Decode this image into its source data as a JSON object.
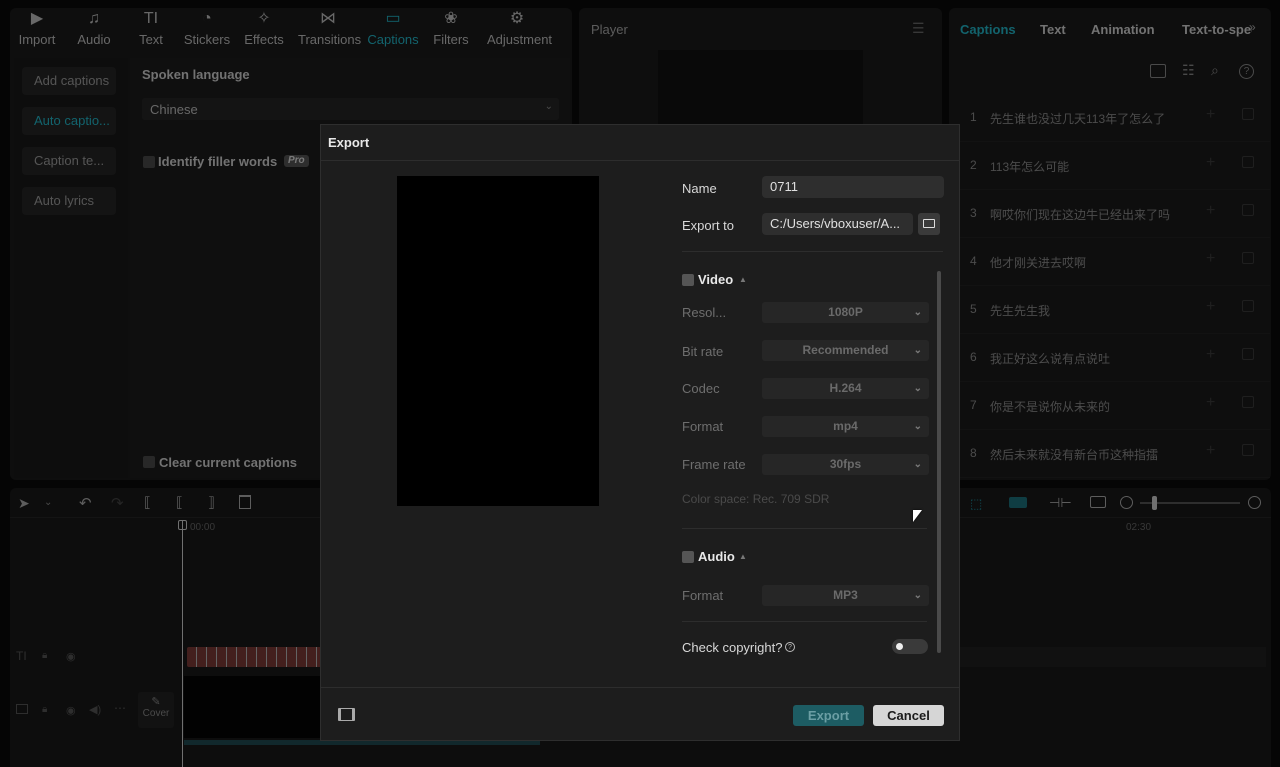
{
  "toolbar": {
    "items": [
      {
        "label": "Import",
        "icon": "import-icon"
      },
      {
        "label": "Audio",
        "icon": "audio-icon"
      },
      {
        "label": "Text",
        "icon": "text-icon"
      },
      {
        "label": "Stickers",
        "icon": "stickers-icon"
      },
      {
        "label": "Effects",
        "icon": "effects-icon"
      },
      {
        "label": "Transitions",
        "icon": "transitions-icon"
      },
      {
        "label": "Captions",
        "icon": "captions-icon",
        "active": true
      },
      {
        "label": "Filters",
        "icon": "filters-icon"
      },
      {
        "label": "Adjustment",
        "icon": "adjustment-icon"
      }
    ]
  },
  "caption_panel": {
    "side_buttons": [
      "Add captions",
      "Auto captio...",
      "Caption te...",
      "Auto lyrics"
    ],
    "spoken_language_label": "Spoken language",
    "language_value": "Chinese",
    "filler_label": "Identify filler words",
    "pro_badge": "Pro",
    "clear_label": "Clear current captions"
  },
  "player": {
    "title": "Player"
  },
  "right_panel": {
    "tabs": [
      "Captions",
      "Text",
      "Animation",
      "Text-to-speech"
    ],
    "captions": [
      {
        "n": "1",
        "text": "先生谁也没过几天113年了怎么了"
      },
      {
        "n": "2",
        "text": "113年怎么可能"
      },
      {
        "n": "3",
        "text": "啊哎你们现在这边牛已经出来了吗"
      },
      {
        "n": "4",
        "text": "他才刚关进去哎啊"
      },
      {
        "n": "5",
        "text": "先生先生我"
      },
      {
        "n": "6",
        "text": "我正好这么说有点说吐"
      },
      {
        "n": "7",
        "text": "你是不是说你从未来的"
      },
      {
        "n": "8",
        "text": "然后未来就没有新台币这种指擂"
      }
    ]
  },
  "timeline": {
    "time_start": "00:00",
    "time_mark": "02:30",
    "cover_label": "Cover"
  },
  "export_dialog": {
    "title": "Export",
    "name_label": "Name",
    "name_value": "0711",
    "export_to_label": "Export to",
    "export_to_value": "C:/Users/vboxuser/A...",
    "video_label": "Video",
    "resolution_label": "Resol...",
    "resolution_value": "1080P",
    "bitrate_label": "Bit rate",
    "bitrate_value": "Recommended",
    "codec_label": "Codec",
    "codec_value": "H.264",
    "format_label": "Format",
    "format_value": "mp4",
    "framerate_label": "Frame rate",
    "framerate_value": "30fps",
    "colorspace_text": "Color space: Rec. 709 SDR",
    "audio_label": "Audio",
    "audio_format_label": "Format",
    "audio_format_value": "MP3",
    "copyright_label": "Check copyright?",
    "export_button": "Export",
    "cancel_button": "Cancel"
  },
  "colors": {
    "accent": "#22b4c6",
    "export_btn": "#1d5c63",
    "panel": "#1b1b1b",
    "dialog": "#1d1d1d"
  }
}
